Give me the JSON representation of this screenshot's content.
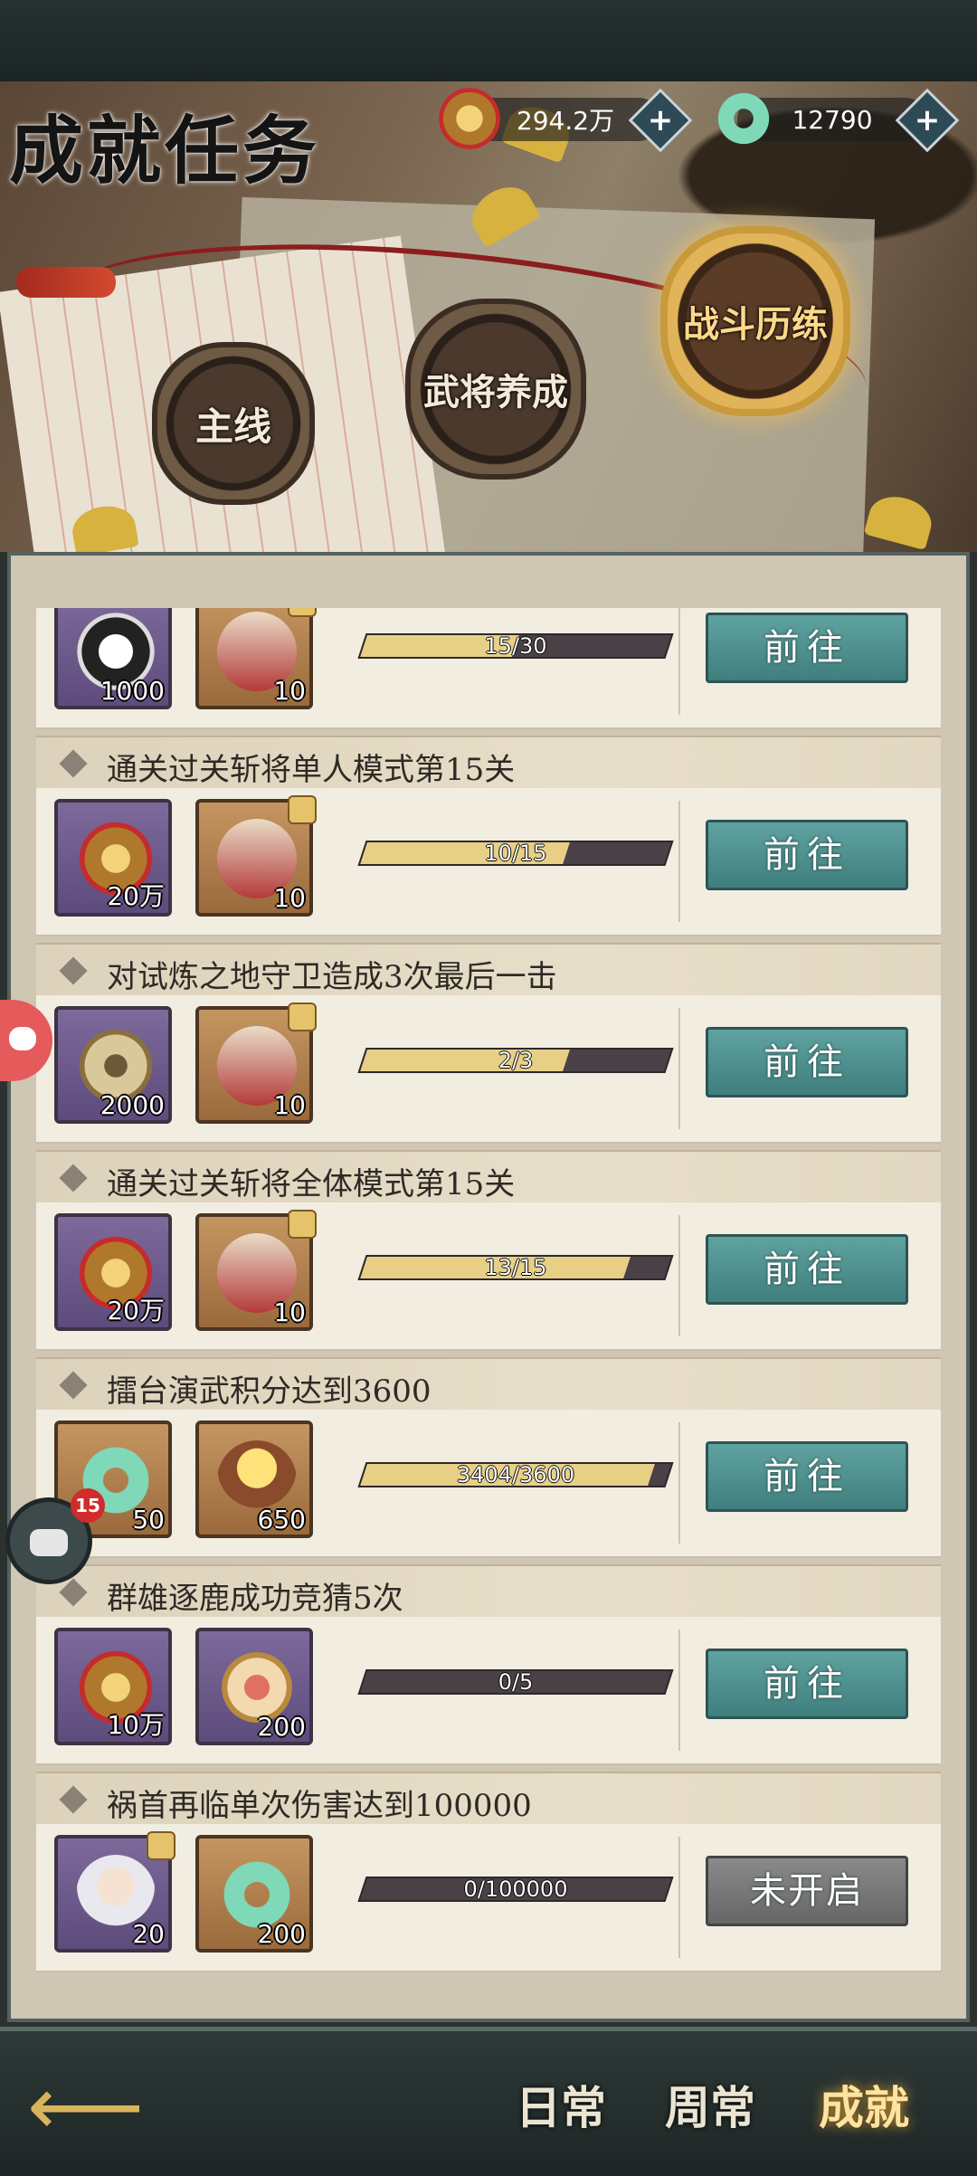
{
  "header": {
    "title": "成就任务",
    "currency_copper": "294.2万",
    "currency_jade": "12790",
    "plus_symbol": "+"
  },
  "categories": [
    {
      "label": "主线",
      "active": false
    },
    {
      "label": "武将养成",
      "active": false
    },
    {
      "label": "战斗历练",
      "active": true
    }
  ],
  "tasks": [
    {
      "title": "",
      "rewards": [
        {
          "icon": "yin-yang-icon",
          "count": "1000",
          "frame": "purple"
        },
        {
          "icon": "general-fragment-icon",
          "count": "10",
          "frame": "orange"
        }
      ],
      "progress_text": "15/30",
      "progress": 0.5,
      "button": "前往"
    },
    {
      "title": "通关过关斩将单人模式第15关",
      "rewards": [
        {
          "icon": "copper-coins-icon",
          "count": "20万",
          "frame": "purple"
        },
        {
          "icon": "general-fragment-icon",
          "count": "10",
          "frame": "orange"
        }
      ],
      "progress_text": "10/15",
      "progress": 0.667,
      "button": "前往"
    },
    {
      "title": "对试炼之地守卫造成3次最后一击",
      "rewards": [
        {
          "icon": "bronze-medal-icon",
          "count": "2000",
          "frame": "purple"
        },
        {
          "icon": "general-fragment-icon",
          "count": "10",
          "frame": "orange"
        }
      ],
      "progress_text": "2/3",
      "progress": 0.667,
      "button": "前往"
    },
    {
      "title": "通关过关斩将全体模式第15关",
      "rewards": [
        {
          "icon": "copper-coins-icon",
          "count": "20万",
          "frame": "purple"
        },
        {
          "icon": "general-fragment-icon",
          "count": "10",
          "frame": "orange"
        }
      ],
      "progress_text": "13/15",
      "progress": 0.867,
      "button": "前往"
    },
    {
      "title": "擂台演武积分达到3600",
      "rewards": [
        {
          "icon": "jade-dragon-icon",
          "count": "50",
          "frame": "orange"
        },
        {
          "icon": "gold-orb-chest-icon",
          "count": "650",
          "frame": "orange"
        }
      ],
      "progress_text": "3404/3600",
      "progress": 0.946,
      "button": "前往"
    },
    {
      "title": "群雄逐鹿成功竞猜5次",
      "rewards": [
        {
          "icon": "copper-coins-icon",
          "count": "10万",
          "frame": "purple"
        },
        {
          "icon": "guess-token-icon",
          "count": "200",
          "frame": "purple"
        }
      ],
      "progress_text": "0/5",
      "progress": 0,
      "button": "前往"
    },
    {
      "title": "祸首再临单次伤害达到100000",
      "rewards": [
        {
          "icon": "hero-portrait-icon",
          "count": "20",
          "frame": "purple"
        },
        {
          "icon": "jade-dragon-icon",
          "count": "200",
          "frame": "orange"
        }
      ],
      "progress_text": "0/100000",
      "progress": 0,
      "button": "未开启"
    }
  ],
  "chat": {
    "badge_count": "15"
  },
  "bottom_tabs": [
    {
      "label": "日常",
      "active": false
    },
    {
      "label": "周常",
      "active": false
    },
    {
      "label": "成就",
      "active": true
    }
  ],
  "back_arrow": "⟵"
}
